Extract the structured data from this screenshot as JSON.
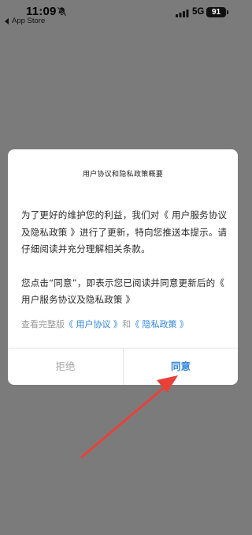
{
  "status_bar": {
    "time": "11:09",
    "back_label": "App Store",
    "network": "5G",
    "battery": "91"
  },
  "dialog": {
    "title": "用户协议和隐私政策概要",
    "paragraph1": "为了更好的维护您的利益，我们对《 用户服务协议及隐私政策 》进行了更新，特向您推送本提示。请仔细阅读并充分理解相关条款。",
    "paragraph2": "您点击“同意”，即表示您已阅读并同意更新后的《 用户服务协议及隐私政策 》",
    "links": {
      "prefix": "查看完整版",
      "user_agreement": "《 用户协议 》",
      "and": "和",
      "privacy_policy": "《 隐私政策 》"
    },
    "buttons": {
      "reject": "拒绝",
      "agree": "同意"
    }
  },
  "colors": {
    "overlay": "#7b7b7b",
    "accent": "#2e86de",
    "annotation_arrow": "#e8413a"
  },
  "icons": [
    "bell-slash-icon",
    "back-triangle-icon",
    "signal-icon",
    "battery-icon",
    "annotation-arrow"
  ]
}
